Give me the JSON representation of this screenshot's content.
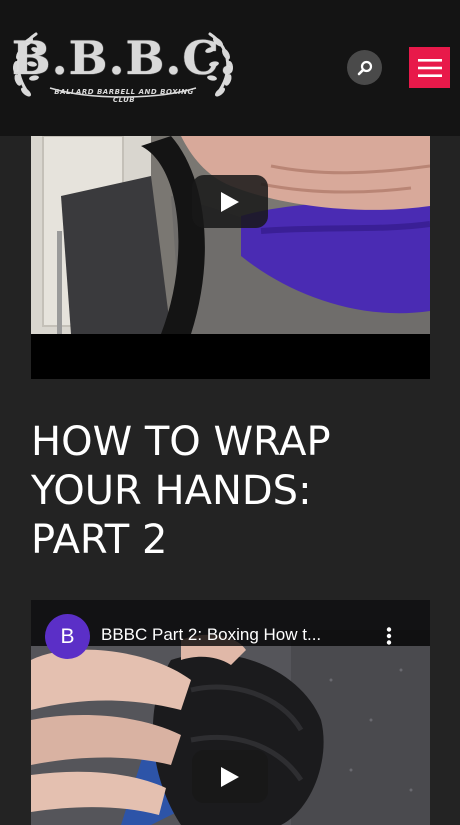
{
  "header": {
    "logo_text": "B.B.B.C.",
    "logo_subtext": "BALLARD BARBELL AND BOXING CLUB",
    "search_icon": "search-icon",
    "menu_icon": "hamburger-menu-icon"
  },
  "colors": {
    "header_bg": "#141414",
    "page_bg": "#232323",
    "menu_accent": "#e8194a",
    "avatar": "#5b2fc7"
  },
  "video1": {
    "play_icon": "play-icon"
  },
  "section": {
    "heading_lines": [
      "HOW TO WRAP",
      "YOUR HANDS:",
      "PART 2"
    ]
  },
  "video2": {
    "channel_initial": "B",
    "title": "BBBC Part 2: Boxing How t...",
    "more_icon": "more-vertical-icon",
    "play_icon": "play-icon"
  }
}
